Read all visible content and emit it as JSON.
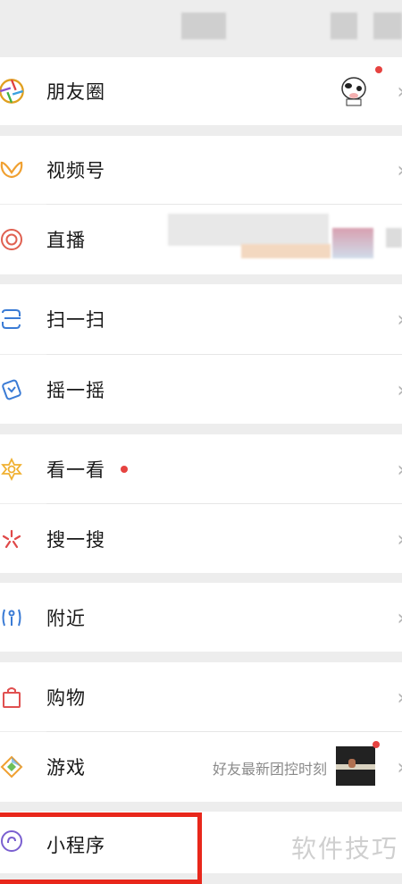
{
  "menu": {
    "moments": "朋友圈",
    "channels": "视频号",
    "live": "直播",
    "scan": "扫一扫",
    "shake": "摇一摇",
    "top_stories": "看一看",
    "search": "搜一搜",
    "nearby": "附近",
    "shopping": "购物",
    "games": "游戏",
    "games_subtitle": "好友最新团控时刻",
    "mini_programs": "小程序"
  },
  "chevron": "›",
  "watermark": "软件技巧",
  "colors": {
    "background": "#ededed",
    "row": "#ffffff",
    "badge": "#e64340",
    "highlight_box": "#e8271b"
  }
}
